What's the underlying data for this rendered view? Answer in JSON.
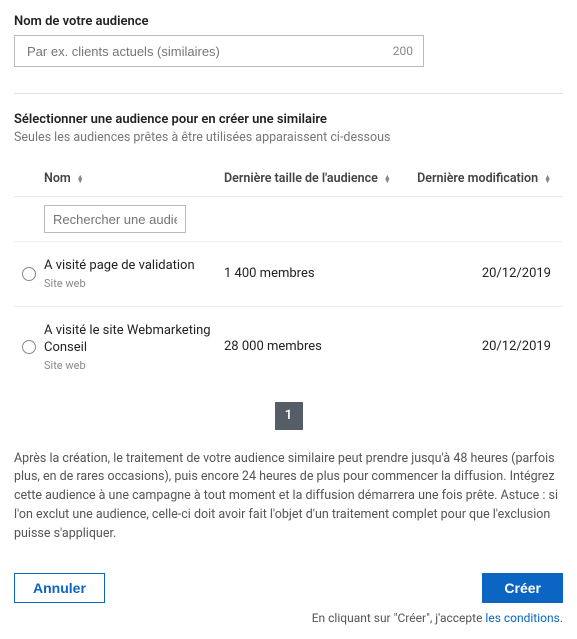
{
  "name_field": {
    "label": "Nom de votre audience",
    "placeholder": "Par ex. clients actuels (similaires)",
    "char_limit": "200"
  },
  "select_section": {
    "title": "Sélectionner une audience pour en créer une similaire",
    "subtitle": "Seules les audiences prêtes à être utilisées apparaissent ci-dessous"
  },
  "table": {
    "headers": {
      "name": "Nom",
      "size": "Dernière taille de l'audience",
      "date": "Dernière modification"
    },
    "search_placeholder": "Rechercher une audienc",
    "rows": [
      {
        "name": "A visité page de validation",
        "type": "Site web",
        "size": "1 400 membres",
        "date": "20/12/2019"
      },
      {
        "name": "A visité le site Webmarketing Conseil",
        "type": "Site web",
        "size": "28 000 membres",
        "date": "20/12/2019"
      }
    ],
    "page": "1"
  },
  "info": "Après la création, le traitement de votre audience similaire peut prendre jusqu'à 48 heures (parfois plus, en de rares occasions), puis encore 24 heures de plus pour commencer la diffusion. Intégrez cette audience à une campagne à tout moment et la diffusion démarrera une fois prête. Astuce : si l'on exclut une audience, celle-ci doit avoir fait l'objet d'un traitement complet pour que l'exclusion puisse s'appliquer.",
  "buttons": {
    "cancel": "Annuler",
    "create": "Créer"
  },
  "terms": {
    "prefix": "En cliquant sur \"Créer\", j'accepte ",
    "link": "les conditions",
    "suffix": "."
  }
}
